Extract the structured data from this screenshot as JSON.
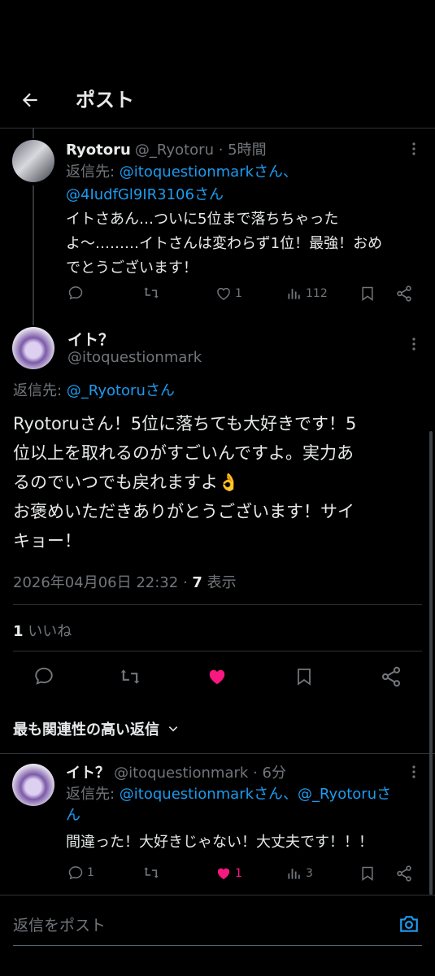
{
  "header": {
    "title": "ポスト"
  },
  "reply1": {
    "name": "Ryotoru",
    "handle": "@_Ryotoru",
    "time": "5時間",
    "reply_to_prefix": "返信先: ",
    "reply_to_a": "@itoquestionmarkさん、",
    "reply_to_b": "@4IudfGl9IR3106さん",
    "lines": [
      "イトさあん…ついに5位まで落ちちゃった",
      "よ〜………イトさんは変わらず1位！最強！おめ",
      "でとうございます！"
    ],
    "likes": "1",
    "views": "112"
  },
  "main": {
    "name": "イト？",
    "handle": "@itoquestionmark",
    "reply_to_prefix": "返信先: ",
    "reply_to": "@_Ryotoruさん",
    "lines": [
      "Ryotoruさん！5位に落ちても大好きです！5",
      "位以上を取れるのがすごいんですよ。実力あ",
      "るのでいつでも戻れますよ👌",
      "お褒めいただきありがとうございます！サイ",
      "キョー！"
    ],
    "date": "2026年04月06日 22:32",
    "sep": " · ",
    "views_count": "7",
    "views_label": " 表示",
    "likes_count": "1",
    "likes_label": " いいね"
  },
  "sort": {
    "label": "最も関連性の高い返信"
  },
  "reply2": {
    "name": "イト？",
    "handle": "@itoquestionmark",
    "time": "6分",
    "reply_to_prefix": "返信先: ",
    "reply_to_a": "@itoquestionmarkさん、",
    "reply_to_b": "@_Ryotoruさ",
    "reply_to_c": "ん",
    "text": "間違った！大好きじゃない！大丈夫です！！！",
    "replies": "1",
    "likes": "1",
    "views": "3"
  },
  "composer": {
    "placeholder": "返信をポスト"
  },
  "colors": {
    "accent": "#1d9bf0",
    "like": "#f91880",
    "muted": "#71767b"
  }
}
